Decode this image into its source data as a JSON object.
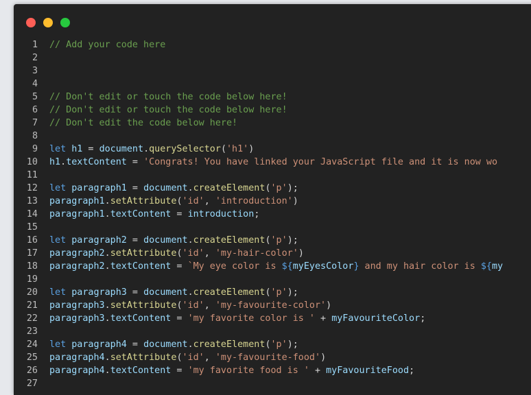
{
  "window": {
    "controls": [
      "close",
      "minimize",
      "maximize"
    ],
    "colors": {
      "close": "#ff5f56",
      "minimize": "#ffbd2e",
      "maximize": "#27c93f"
    }
  },
  "editor": {
    "lines": [
      {
        "n": "1",
        "tokens": [
          {
            "t": "// Add your code here",
            "c": "comment"
          }
        ]
      },
      {
        "n": "2",
        "tokens": []
      },
      {
        "n": "3",
        "tokens": []
      },
      {
        "n": "4",
        "tokens": []
      },
      {
        "n": "5",
        "tokens": [
          {
            "t": "// Don't edit or touch the code below here!",
            "c": "comment"
          }
        ]
      },
      {
        "n": "6",
        "tokens": [
          {
            "t": "// Don't edit or touch the code below here!",
            "c": "comment"
          }
        ]
      },
      {
        "n": "7",
        "tokens": [
          {
            "t": "// Don't edit the code below here!",
            "c": "comment"
          }
        ]
      },
      {
        "n": "8",
        "tokens": []
      },
      {
        "n": "9",
        "tokens": [
          {
            "t": "let ",
            "c": "keyword"
          },
          {
            "t": "h1",
            "c": "var"
          },
          {
            "t": " = ",
            "c": "plain"
          },
          {
            "t": "document",
            "c": "var"
          },
          {
            "t": ".",
            "c": "plain"
          },
          {
            "t": "querySelector",
            "c": "fn"
          },
          {
            "t": "(",
            "c": "plain"
          },
          {
            "t": "'h1'",
            "c": "str"
          },
          {
            "t": ")",
            "c": "plain"
          }
        ]
      },
      {
        "n": "10",
        "tokens": [
          {
            "t": "h1",
            "c": "var"
          },
          {
            "t": ".",
            "c": "plain"
          },
          {
            "t": "textContent",
            "c": "var"
          },
          {
            "t": " = ",
            "c": "plain"
          },
          {
            "t": "'Congrats! You have linked your JavaScript file and it is now wo",
            "c": "str"
          }
        ]
      },
      {
        "n": "11",
        "tokens": []
      },
      {
        "n": "12",
        "tokens": [
          {
            "t": "let ",
            "c": "keyword"
          },
          {
            "t": "paragraph1",
            "c": "var"
          },
          {
            "t": " = ",
            "c": "plain"
          },
          {
            "t": "document",
            "c": "var"
          },
          {
            "t": ".",
            "c": "plain"
          },
          {
            "t": "createElement",
            "c": "fn"
          },
          {
            "t": "(",
            "c": "plain"
          },
          {
            "t": "'p'",
            "c": "str"
          },
          {
            "t": ");",
            "c": "plain"
          }
        ]
      },
      {
        "n": "13",
        "tokens": [
          {
            "t": "paragraph1",
            "c": "var"
          },
          {
            "t": ".",
            "c": "plain"
          },
          {
            "t": "setAttribute",
            "c": "fn"
          },
          {
            "t": "(",
            "c": "plain"
          },
          {
            "t": "'id'",
            "c": "str"
          },
          {
            "t": ", ",
            "c": "plain"
          },
          {
            "t": "'introduction'",
            "c": "str"
          },
          {
            "t": ")",
            "c": "plain"
          }
        ]
      },
      {
        "n": "14",
        "tokens": [
          {
            "t": "paragraph1",
            "c": "var"
          },
          {
            "t": ".",
            "c": "plain"
          },
          {
            "t": "textContent",
            "c": "var"
          },
          {
            "t": " = ",
            "c": "plain"
          },
          {
            "t": "introduction",
            "c": "var"
          },
          {
            "t": ";",
            "c": "plain"
          }
        ]
      },
      {
        "n": "15",
        "tokens": []
      },
      {
        "n": "16",
        "tokens": [
          {
            "t": "let ",
            "c": "keyword"
          },
          {
            "t": "paragraph2",
            "c": "var"
          },
          {
            "t": " = ",
            "c": "plain"
          },
          {
            "t": "document",
            "c": "var"
          },
          {
            "t": ".",
            "c": "plain"
          },
          {
            "t": "createElement",
            "c": "fn"
          },
          {
            "t": "(",
            "c": "plain"
          },
          {
            "t": "'p'",
            "c": "str"
          },
          {
            "t": ");",
            "c": "plain"
          }
        ]
      },
      {
        "n": "17",
        "tokens": [
          {
            "t": "paragraph2",
            "c": "var"
          },
          {
            "t": ".",
            "c": "plain"
          },
          {
            "t": "setAttribute",
            "c": "fn"
          },
          {
            "t": "(",
            "c": "plain"
          },
          {
            "t": "'id'",
            "c": "str"
          },
          {
            "t": ", ",
            "c": "plain"
          },
          {
            "t": "'my-hair-color'",
            "c": "str"
          },
          {
            "t": ")",
            "c": "plain"
          }
        ]
      },
      {
        "n": "18",
        "tokens": [
          {
            "t": "paragraph2",
            "c": "var"
          },
          {
            "t": ".",
            "c": "plain"
          },
          {
            "t": "textContent",
            "c": "var"
          },
          {
            "t": " = ",
            "c": "plain"
          },
          {
            "t": "`My eye color is ",
            "c": "str"
          },
          {
            "t": "${",
            "c": "keyword"
          },
          {
            "t": "myEyesColor",
            "c": "var"
          },
          {
            "t": "}",
            "c": "keyword"
          },
          {
            "t": " and my hair color is ",
            "c": "str"
          },
          {
            "t": "${",
            "c": "keyword"
          },
          {
            "t": "my",
            "c": "var"
          }
        ]
      },
      {
        "n": "19",
        "tokens": []
      },
      {
        "n": "20",
        "tokens": [
          {
            "t": "let ",
            "c": "keyword"
          },
          {
            "t": "paragraph3",
            "c": "var"
          },
          {
            "t": " = ",
            "c": "plain"
          },
          {
            "t": "document",
            "c": "var"
          },
          {
            "t": ".",
            "c": "plain"
          },
          {
            "t": "createElement",
            "c": "fn"
          },
          {
            "t": "(",
            "c": "plain"
          },
          {
            "t": "'p'",
            "c": "str"
          },
          {
            "t": ");",
            "c": "plain"
          }
        ]
      },
      {
        "n": "21",
        "tokens": [
          {
            "t": "paragraph3",
            "c": "var"
          },
          {
            "t": ".",
            "c": "plain"
          },
          {
            "t": "setAttribute",
            "c": "fn"
          },
          {
            "t": "(",
            "c": "plain"
          },
          {
            "t": "'id'",
            "c": "str"
          },
          {
            "t": ", ",
            "c": "plain"
          },
          {
            "t": "'my-favourite-color'",
            "c": "str"
          },
          {
            "t": ")",
            "c": "plain"
          }
        ]
      },
      {
        "n": "22",
        "tokens": [
          {
            "t": "paragraph3",
            "c": "var"
          },
          {
            "t": ".",
            "c": "plain"
          },
          {
            "t": "textContent",
            "c": "var"
          },
          {
            "t": " = ",
            "c": "plain"
          },
          {
            "t": "'my favorite color is '",
            "c": "str"
          },
          {
            "t": " + ",
            "c": "plain"
          },
          {
            "t": "myFavouriteColor",
            "c": "var"
          },
          {
            "t": ";",
            "c": "plain"
          }
        ]
      },
      {
        "n": "23",
        "tokens": []
      },
      {
        "n": "24",
        "tokens": [
          {
            "t": "let ",
            "c": "keyword"
          },
          {
            "t": "paragraph4",
            "c": "var"
          },
          {
            "t": " = ",
            "c": "plain"
          },
          {
            "t": "document",
            "c": "var"
          },
          {
            "t": ".",
            "c": "plain"
          },
          {
            "t": "createElement",
            "c": "fn"
          },
          {
            "t": "(",
            "c": "plain"
          },
          {
            "t": "'p'",
            "c": "str"
          },
          {
            "t": ");",
            "c": "plain"
          }
        ]
      },
      {
        "n": "25",
        "tokens": [
          {
            "t": "paragraph4",
            "c": "var"
          },
          {
            "t": ".",
            "c": "plain"
          },
          {
            "t": "setAttribute",
            "c": "fn"
          },
          {
            "t": "(",
            "c": "plain"
          },
          {
            "t": "'id'",
            "c": "str"
          },
          {
            "t": ", ",
            "c": "plain"
          },
          {
            "t": "'my-favourite-food'",
            "c": "str"
          },
          {
            "t": ")",
            "c": "plain"
          }
        ]
      },
      {
        "n": "26",
        "tokens": [
          {
            "t": "paragraph4",
            "c": "var"
          },
          {
            "t": ".",
            "c": "plain"
          },
          {
            "t": "textContent",
            "c": "var"
          },
          {
            "t": " = ",
            "c": "plain"
          },
          {
            "t": "'my favorite food is '",
            "c": "str"
          },
          {
            "t": " + ",
            "c": "plain"
          },
          {
            "t": "myFavouriteFood",
            "c": "var"
          },
          {
            "t": ";",
            "c": "plain"
          }
        ]
      },
      {
        "n": "27",
        "tokens": []
      }
    ]
  }
}
